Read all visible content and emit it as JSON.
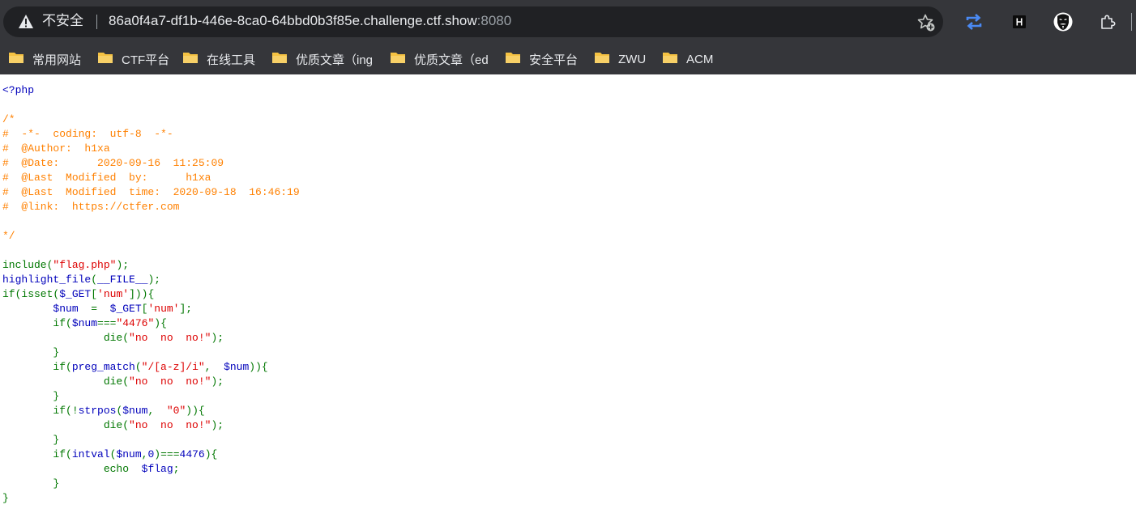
{
  "address_bar": {
    "security_label": "不安全",
    "host": "86a0f4a7-df1b-446e-8ca0-64bbd0b3f85e.challenge.ctf.show",
    "port": ":8080"
  },
  "bookmarks": [
    {
      "label": "常用网站"
    },
    {
      "label": "CTF平台"
    },
    {
      "label": "在线工具"
    },
    {
      "label": "优质文章（ing"
    },
    {
      "label": "优质文章（ed"
    },
    {
      "label": "安全平台"
    },
    {
      "label": "ZWU"
    },
    {
      "label": "ACM"
    }
  ],
  "toolbar_icons": [
    "add-favorite-icon",
    "sync-icon",
    "h-extension-icon",
    "anonymous-mask-icon",
    "extensions-icon"
  ],
  "colors": {
    "default": "#0000bb",
    "comment": "#ff8000",
    "keyword": "#007700",
    "string": "#dd0000",
    "sync_icon": "#4a8af4",
    "folder": "#f5c242"
  },
  "code_lines": [
    [
      [
        "default",
        "<?php"
      ]
    ],
    [],
    [
      [
        "comment",
        "/*"
      ]
    ],
    [
      [
        "comment",
        "#  -*-  coding:  utf-8  -*-"
      ]
    ],
    [
      [
        "comment",
        "#  @Author:  h1xa"
      ]
    ],
    [
      [
        "comment",
        "#  @Date:      2020-09-16  11:25:09"
      ]
    ],
    [
      [
        "comment",
        "#  @Last  Modified  by:      h1xa"
      ]
    ],
    [
      [
        "comment",
        "#  @Last  Modified  time:  2020-09-18  16:46:19"
      ]
    ],
    [
      [
        "comment",
        "#  @link:  https://ctfer.com"
      ]
    ],
    [],
    [
      [
        "comment",
        "*/"
      ]
    ],
    [],
    [
      [
        "keyword",
        "include("
      ],
      [
        "string",
        "\"flag.php\""
      ],
      [
        "keyword",
        ");"
      ]
    ],
    [
      [
        "default",
        "highlight_file"
      ],
      [
        "keyword",
        "("
      ],
      [
        "default",
        "__FILE__"
      ],
      [
        "keyword",
        ");"
      ]
    ],
    [
      [
        "keyword",
        "if(isset("
      ],
      [
        "default",
        "$_GET"
      ],
      [
        "keyword",
        "["
      ],
      [
        "string",
        "'num'"
      ],
      [
        "keyword",
        "])){"
      ]
    ],
    [
      [
        "keyword",
        "        "
      ],
      [
        "default",
        "$num  "
      ],
      [
        "keyword",
        "=  "
      ],
      [
        "default",
        "$_GET"
      ],
      [
        "keyword",
        "["
      ],
      [
        "string",
        "'num'"
      ],
      [
        "keyword",
        "];"
      ]
    ],
    [
      [
        "keyword",
        "        if("
      ],
      [
        "default",
        "$num"
      ],
      [
        "keyword",
        "==="
      ],
      [
        "string",
        "\"4476\""
      ],
      [
        "keyword",
        "){"
      ]
    ],
    [
      [
        "keyword",
        "                die("
      ],
      [
        "string",
        "\"no  no  no!\""
      ],
      [
        "keyword",
        ");"
      ]
    ],
    [
      [
        "keyword",
        "        }"
      ]
    ],
    [
      [
        "keyword",
        "        if("
      ],
      [
        "default",
        "preg_match"
      ],
      [
        "keyword",
        "("
      ],
      [
        "string",
        "\"/[a-z]/i\""
      ],
      [
        "keyword",
        ",  "
      ],
      [
        "default",
        "$num"
      ],
      [
        "keyword",
        ")){"
      ]
    ],
    [
      [
        "keyword",
        "                die("
      ],
      [
        "string",
        "\"no  no  no!\""
      ],
      [
        "keyword",
        ");"
      ]
    ],
    [
      [
        "keyword",
        "        }"
      ]
    ],
    [
      [
        "keyword",
        "        if(!"
      ],
      [
        "default",
        "strpos"
      ],
      [
        "keyword",
        "("
      ],
      [
        "default",
        "$num"
      ],
      [
        "keyword",
        ",  "
      ],
      [
        "string",
        "\"0\""
      ],
      [
        "keyword",
        ")){"
      ]
    ],
    [
      [
        "keyword",
        "                die("
      ],
      [
        "string",
        "\"no  no  no!\""
      ],
      [
        "keyword",
        ");"
      ]
    ],
    [
      [
        "keyword",
        "        }"
      ]
    ],
    [
      [
        "keyword",
        "        if("
      ],
      [
        "default",
        "intval"
      ],
      [
        "keyword",
        "("
      ],
      [
        "default",
        "$num"
      ],
      [
        "keyword",
        ","
      ],
      [
        "default",
        "0"
      ],
      [
        "keyword",
        ")==="
      ],
      [
        "default",
        "4476"
      ],
      [
        "keyword",
        "){"
      ]
    ],
    [
      [
        "keyword",
        "                echo  "
      ],
      [
        "default",
        "$flag"
      ],
      [
        "keyword",
        ";"
      ]
    ],
    [
      [
        "keyword",
        "        }"
      ]
    ],
    [
      [
        "keyword",
        "}"
      ]
    ]
  ]
}
